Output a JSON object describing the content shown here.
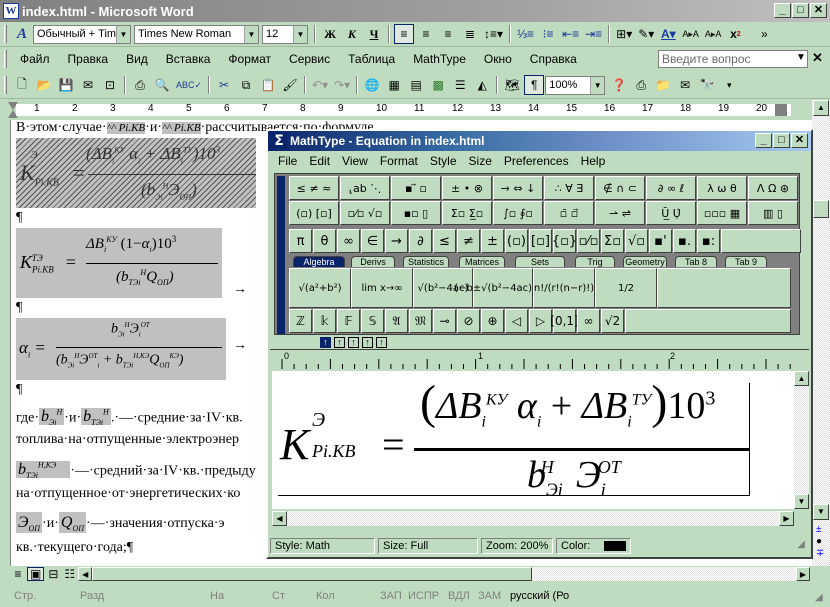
{
  "window": {
    "title": "index.html - Microsoft Word",
    "controls": [
      "minimize",
      "maximize",
      "close"
    ]
  },
  "formatting_toolbar": {
    "style": "Обычный + Time",
    "font": "Times New Roman",
    "size": "12",
    "bold": "Ж",
    "italic": "К",
    "underline": "Ч"
  },
  "menu": {
    "items": [
      "Файл",
      "Правка",
      "Вид",
      "Вставка",
      "Формат",
      "Сервис",
      "Таблица",
      "MathType",
      "Окно",
      "Справка"
    ],
    "help_placeholder": "Введите вопрос"
  },
  "standard_toolbar": {
    "zoom": "100%"
  },
  "ruler": {
    "marks": [
      "1",
      "2",
      "3",
      "4",
      "5",
      "6",
      "7",
      "8",
      "9",
      "10",
      "11",
      "12",
      "13",
      "14",
      "15",
      "16",
      "17",
      "18",
      "19",
      "20"
    ]
  },
  "document": {
    "line1": "В·этом·случае·",
    "line1_mid": "·и·",
    "line1_end": "·рассчитывается·по·формуле",
    "pilcrow": "¶",
    "arrow": "→",
    "para_gde": "где·",
    "and": "·и·",
    "dash1": ".·—·средние·за·IV·кв.",
    "line_fuel": "топлива·на·отпущенные·электроэнер",
    "dash2": "·—·средний·за·IV·кв.·предыду",
    "line_otp": "на·отпущенное·от·энергетических·ко",
    "dash3": "·—·значения·отпуска·э",
    "line_last": "кв.·текущего·года;¶"
  },
  "mathtype": {
    "title": "MathType - Equation in index.html",
    "menu": [
      "File",
      "Edit",
      "View",
      "Format",
      "Style",
      "Size",
      "Preferences",
      "Help"
    ],
    "row1": [
      "≤ ≠ ≈",
      "⸤ab ⋱",
      "▪ ⃗ ▫",
      "± • ⊗",
      "→ ⇔ ↓",
      "∴ ∀ ∃",
      "∉ ∩ ⊂",
      "∂ ∞ ℓ",
      "λ ω θ",
      "Λ Ω ⊛"
    ],
    "row2": [
      "(▫) [▫]",
      "▫⁄▫ √▫",
      "▪▫ ▯",
      "Σ▫ Σ̲▫",
      "∫▫ ∮▫",
      "▫̄ ▫⃗",
      "⇀ ⇌",
      "Ū̲ Ụ̇",
      "▫▫▫ ▦",
      "▥ ▯"
    ],
    "row3": [
      "π",
      "θ",
      "∞",
      "∈",
      "→",
      "∂",
      "≤",
      "≠",
      "±",
      "(▫)",
      "[▫]",
      "{▫}",
      "▫⁄▫",
      "Σ̇▫",
      "√▫",
      "▪'",
      "▪.",
      "▪:"
    ],
    "tabs": [
      "Algebra",
      "Derivs",
      "Statistics",
      "Matrices",
      "Sets",
      "Trig",
      "Geometry",
      "Tab 8",
      "Tab 9"
    ],
    "selected_tab": "Algebra",
    "templates": [
      "√(a²+b²)",
      "lim x→∞",
      "√(b²−4ac)",
      "(−b±√(b²−4ac))/2a",
      "n!/(r!(n−r)!)",
      "1/2"
    ],
    "symbols": [
      "ℤ",
      "𝕜",
      "𝔽",
      "𝕊",
      "𝔄",
      "𝔐",
      "⊸",
      "⊘",
      "⊕",
      "◁",
      "▷",
      "[0,1]",
      "∞",
      "√2"
    ],
    "status": {
      "style": "Style: Math",
      "size": "Size: Full",
      "zoom": "Zoom: 200%",
      "color_label": "Color:",
      "color_value": "#000000"
    },
    "ruler_marks": [
      "0",
      "1",
      "2"
    ]
  },
  "statusbar": {
    "page": "Стр.",
    "section": "Разд",
    "at": "На",
    "line": "Ст",
    "col": "Кол",
    "rec": "ЗАП",
    "trk": "ИСПР",
    "ext": "ВДЛ",
    "ovr": "ЗАМ",
    "lang": "русский (Ро"
  }
}
